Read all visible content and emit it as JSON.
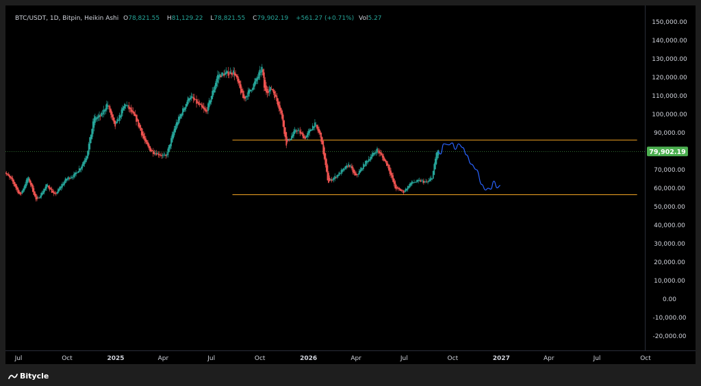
{
  "legend": {
    "symbol": "BTC/USDT, 1D, Bitpin, Heikin Ashi",
    "open_label": "O",
    "open": "78,821.55",
    "high_label": "H",
    "high": "81,129.22",
    "low_label": "L",
    "low": "78,821.55",
    "close_label": "C",
    "close": "79,902.19",
    "change": "+561.27 (+0.71%)",
    "vol_label": "Vol",
    "vol": "5.27"
  },
  "footer": {
    "brand": "Bitycle"
  },
  "colors": {
    "up": "#26a69a",
    "down": "#ef5350",
    "projection": "#2962ff",
    "range_lines": "#f5a623",
    "price_tag": "#4caf50",
    "background": "#000000"
  },
  "chart_data": {
    "type": "candlestick",
    "style": "Heikin Ashi",
    "timeframe": "1D",
    "ylim": [
      -25000,
      155000
    ],
    "y_ticks": [
      150000,
      140000,
      130000,
      120000,
      110000,
      100000,
      90000,
      80000,
      70000,
      60000,
      50000,
      40000,
      30000,
      20000,
      10000,
      0,
      -10000,
      -20000
    ],
    "y_tick_labels": [
      "150,000.00",
      "140,000.00",
      "130,000.00",
      "120,000.00",
      "110,000.00",
      "100,000.00",
      "90,000.00",
      "80,000.00",
      "70,000.00",
      "60,000.00",
      "50,000.00",
      "40,000.00",
      "30,000.00",
      "20,000.00",
      "10,000.00",
      "0.00",
      "-10,000.00",
      "-20,000.00"
    ],
    "x_ticks": [
      {
        "label": "Jul",
        "date": "2024-07-01",
        "bold": false
      },
      {
        "label": "Oct",
        "date": "2024-10-01",
        "bold": false
      },
      {
        "label": "2025",
        "date": "2025-01-01",
        "bold": true
      },
      {
        "label": "Apr",
        "date": "2025-04-01",
        "bold": false
      },
      {
        "label": "Jul",
        "date": "2025-07-01",
        "bold": false
      },
      {
        "label": "Oct",
        "date": "2025-10-01",
        "bold": false
      },
      {
        "label": "2026",
        "date": "2026-01-01",
        "bold": true
      },
      {
        "label": "Apr",
        "date": "2026-04-01",
        "bold": false
      },
      {
        "label": "Jul",
        "date": "2026-07-01",
        "bold": false
      },
      {
        "label": "Oct",
        "date": "2026-10-01",
        "bold": false
      },
      {
        "label": "2027",
        "date": "2027-01-01",
        "bold": true
      },
      {
        "label": "Apr",
        "date": "2027-04-01",
        "bold": false
      },
      {
        "label": "Jul",
        "date": "2027-07-01",
        "bold": false
      },
      {
        "label": "Oct",
        "date": "2027-10-01",
        "bold": false
      }
    ],
    "price_path": [
      {
        "date": "2024-06-01",
        "price": 70000
      },
      {
        "date": "2024-06-20",
        "price": 64000
      },
      {
        "date": "2024-07-05",
        "price": 56000
      },
      {
        "date": "2024-07-20",
        "price": 66000
      },
      {
        "date": "2024-08-05",
        "price": 53000
      },
      {
        "date": "2024-08-25",
        "price": 62000
      },
      {
        "date": "2024-09-08",
        "price": 56000
      },
      {
        "date": "2024-09-30",
        "price": 65000
      },
      {
        "date": "2024-10-15",
        "price": 67000
      },
      {
        "date": "2024-10-29",
        "price": 72000
      },
      {
        "date": "2024-11-08",
        "price": 78000
      },
      {
        "date": "2024-11-22",
        "price": 98000
      },
      {
        "date": "2024-12-05",
        "price": 99000
      },
      {
        "date": "2024-12-17",
        "price": 106000
      },
      {
        "date": "2024-12-31",
        "price": 93000
      },
      {
        "date": "2025-01-20",
        "price": 106000
      },
      {
        "date": "2025-02-10",
        "price": 97000
      },
      {
        "date": "2025-02-28",
        "price": 84000
      },
      {
        "date": "2025-03-10",
        "price": 80000
      },
      {
        "date": "2025-04-07",
        "price": 77000
      },
      {
        "date": "2025-04-25",
        "price": 94000
      },
      {
        "date": "2025-05-22",
        "price": 110000
      },
      {
        "date": "2025-06-22",
        "price": 101000
      },
      {
        "date": "2025-07-14",
        "price": 121000
      },
      {
        "date": "2025-08-14",
        "price": 123000
      },
      {
        "date": "2025-09-01",
        "price": 108000
      },
      {
        "date": "2025-09-20",
        "price": 116000
      },
      {
        "date": "2025-10-06",
        "price": 125000
      },
      {
        "date": "2025-10-11",
        "price": 112000
      },
      {
        "date": "2025-10-25",
        "price": 114000
      },
      {
        "date": "2025-11-10",
        "price": 102000
      },
      {
        "date": "2025-11-21",
        "price": 84000
      },
      {
        "date": "2025-12-10",
        "price": 92000
      },
      {
        "date": "2025-12-26",
        "price": 87000
      },
      {
        "date": "2026-01-13",
        "price": 95000
      },
      {
        "date": "2026-01-25",
        "price": 88000
      },
      {
        "date": "2026-02-08",
        "price": 63000
      },
      {
        "date": "2026-03-01",
        "price": 68000
      },
      {
        "date": "2026-03-20",
        "price": 73000
      },
      {
        "date": "2026-04-01",
        "price": 66000
      },
      {
        "date": "2026-04-20",
        "price": 74000
      },
      {
        "date": "2026-05-12",
        "price": 81000
      },
      {
        "date": "2026-06-01",
        "price": 72000
      },
      {
        "date": "2026-06-15",
        "price": 60000
      },
      {
        "date": "2026-07-01",
        "price": 58000
      },
      {
        "date": "2026-07-15",
        "price": 63000
      },
      {
        "date": "2026-08-01",
        "price": 64000
      },
      {
        "date": "2026-08-15",
        "price": 63000
      },
      {
        "date": "2026-08-24",
        "price": 66000
      },
      {
        "date": "2026-09-01",
        "price": 79000
      },
      {
        "date": "2026-09-03",
        "price": 79902
      }
    ],
    "projection": [
      {
        "date": "2026-09-03",
        "price": 79902
      },
      {
        "date": "2026-09-08",
        "price": 78500
      },
      {
        "date": "2026-09-14",
        "price": 84000
      },
      {
        "date": "2026-09-24",
        "price": 83500
      },
      {
        "date": "2026-09-30",
        "price": 84500
      },
      {
        "date": "2026-10-06",
        "price": 81000
      },
      {
        "date": "2026-10-12",
        "price": 84000
      },
      {
        "date": "2026-10-20",
        "price": 82000
      },
      {
        "date": "2026-10-27",
        "price": 78000
      },
      {
        "date": "2026-11-05",
        "price": 73000
      },
      {
        "date": "2026-11-15",
        "price": 70000
      },
      {
        "date": "2026-11-25",
        "price": 62000
      },
      {
        "date": "2026-12-02",
        "price": 59000
      },
      {
        "date": "2026-12-07",
        "price": 60000
      },
      {
        "date": "2026-12-12",
        "price": 59500
      },
      {
        "date": "2026-12-18",
        "price": 63800
      },
      {
        "date": "2026-12-24",
        "price": 60200
      },
      {
        "date": "2026-12-30",
        "price": 61500
      }
    ],
    "horizontal_lines": [
      {
        "name": "range-top",
        "start": "2025-08-10",
        "end": "2027-09-15",
        "price": 86000
      },
      {
        "name": "range-bottom",
        "start": "2025-08-10",
        "end": "2027-09-15",
        "price": 56500
      }
    ],
    "last_price": 79902.19,
    "last_price_label": "79,902.19"
  }
}
